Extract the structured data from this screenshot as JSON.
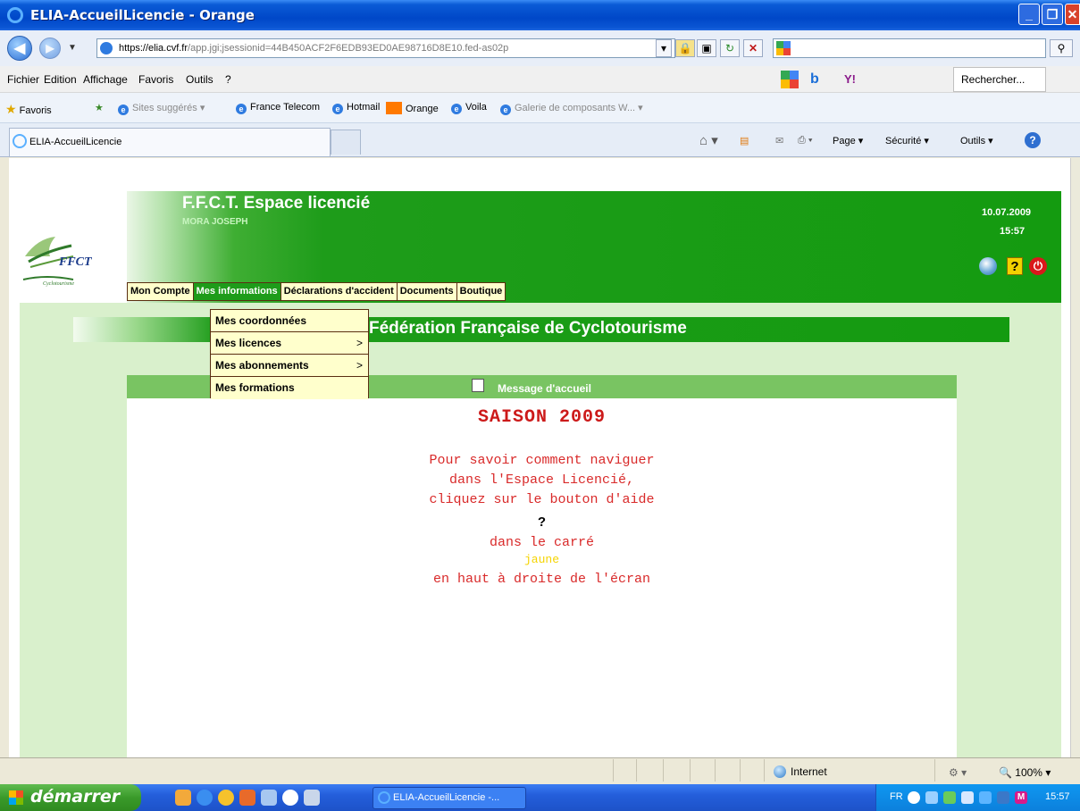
{
  "window": {
    "title": "ELIA-AccueilLicencie - Orange"
  },
  "address": {
    "url_host": "https://elia.cvf.fr",
    "url_rest": "/app.jgi;jsessionid=44B450ACF2F6EDB93ED0AE98716D8E10.fed-as02p"
  },
  "menubar": {
    "items": [
      "Fichier",
      "Edition",
      "Affichage",
      "Favoris",
      "Outils",
      "?"
    ],
    "search_label": "Rechercher..."
  },
  "favorites": {
    "label": "Favoris",
    "items": [
      "Sites suggérés ▾",
      "France Telecom",
      "Hotmail",
      "Orange",
      "Voila",
      "Galerie de composants W... ▾"
    ]
  },
  "tab": {
    "title": "ELIA-AccueilLicencie"
  },
  "commandbar": {
    "page": "Page ▾",
    "securite": "Sécurité ▾",
    "outils": "Outils ▾"
  },
  "header": {
    "site_title": "F.F.C.T. Espace licencié",
    "user_name": "MORA JOSEPH",
    "date": "10.07.2009",
    "time": "15:57",
    "help_label": "?",
    "power_label": "⏻"
  },
  "nav": {
    "tabs": [
      "Mon Compte",
      "Mes informations",
      "Déclarations d'accident",
      "Documents",
      "Boutique"
    ],
    "active_index": 1
  },
  "dropdown": {
    "items": [
      {
        "label": "Mes coordonnées",
        "arrow": ""
      },
      {
        "label": "Mes licences",
        "arrow": ">"
      },
      {
        "label": "Mes abonnements",
        "arrow": ">"
      },
      {
        "label": "Mes formations",
        "arrow": ""
      }
    ]
  },
  "federation": {
    "title": "Fédération Française de Cyclotourisme"
  },
  "message": {
    "header": "Message d'accueil",
    "title": "SAISON 2009",
    "line1": "Pour savoir comment naviguer",
    "line2": "dans l'Espace Licencié,",
    "line3": "cliquez sur le bouton d'aide",
    "question_mark": "?",
    "line4": "dans le carré",
    "line5": "jaune",
    "line6": "en haut à droite de l'écran"
  },
  "statusbar": {
    "zone": "Internet",
    "zoom": "100%"
  },
  "taskbar": {
    "start": "démarrer",
    "task": "ELIA-AccueilLicencie -...",
    "lang": "FR",
    "clock": "15:57"
  },
  "colors": {
    "accent_green": "#1e9c1a",
    "menu_yellow": "#ffffcc",
    "message_red": "#d92a2a",
    "help_yellow": "#f2d100"
  },
  "icons": [
    "ie-icon",
    "back-icon",
    "forward-icon",
    "lock-icon",
    "refresh-icon",
    "stop-icon",
    "search-icon",
    "star-icon",
    "home-icon",
    "print-icon",
    "help-globe-icon",
    "help-icon",
    "power-icon",
    "message-icon",
    "globe-icon",
    "windows-flag-icon"
  ]
}
